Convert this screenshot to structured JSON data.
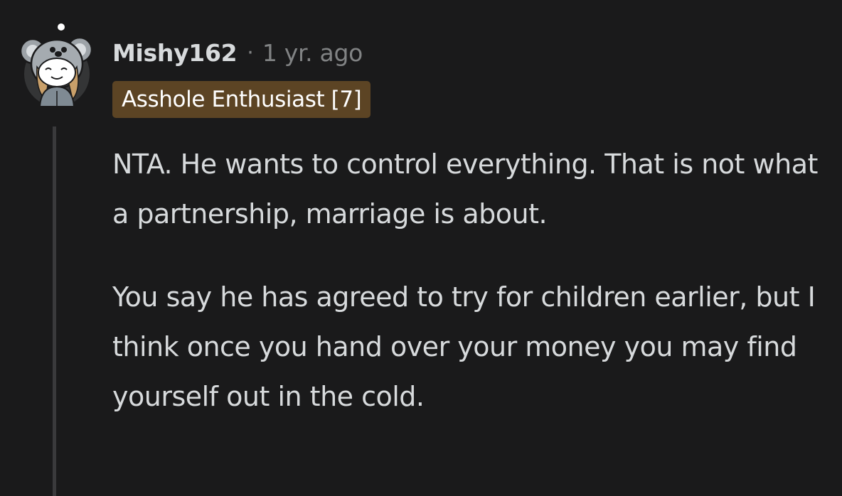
{
  "comment": {
    "username": "Mishy162",
    "separator": "·",
    "timestamp": "1 yr. ago",
    "flair": "Asshole Enthusiast [7]",
    "avatar_icon": "koala-hood-snoo-avatar-icon",
    "paragraphs": [
      "NTA. He wants to control everything. That is not what a partnership, marriage is about.",
      "You say he has agreed to try for children earlier, but I think once you hand over your money you may find yourself out in the cold."
    ]
  },
  "colors": {
    "background": "#1a1a1b",
    "text": "#d7dadc",
    "meta": "#818384",
    "flair_bg": "#5c4424",
    "thread_line": "#3a3a3c"
  }
}
